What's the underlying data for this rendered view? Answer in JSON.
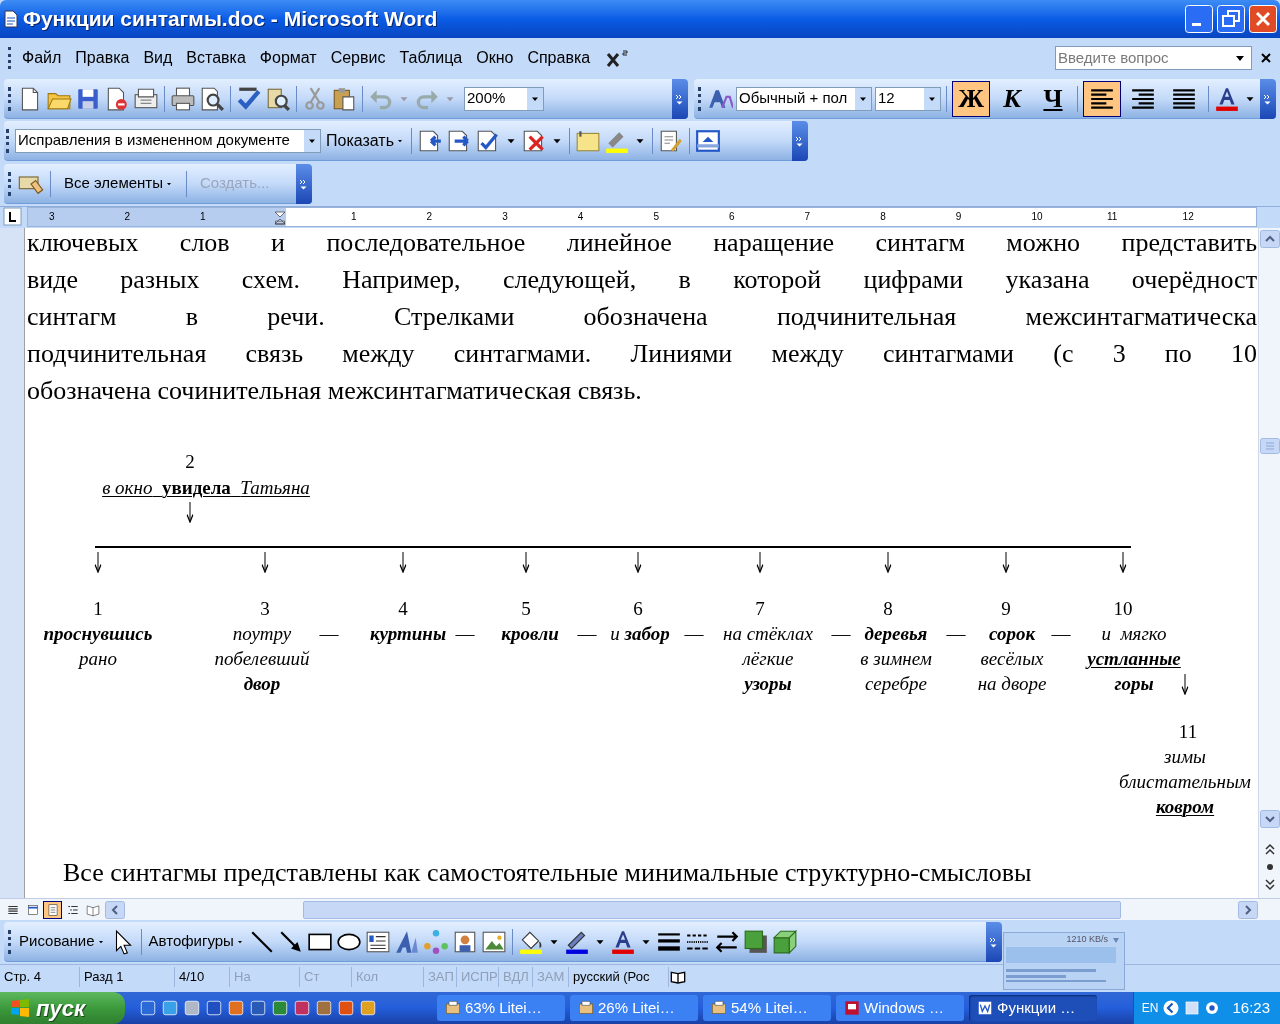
{
  "window": {
    "title": "Функции синтагмы.doc - Microsoft Word"
  },
  "menu_bar": {
    "items": [
      "Файл",
      "Правка",
      "Вид",
      "Вставка",
      "Формат",
      "Сервис",
      "Таблица",
      "Окно",
      "Справка"
    ],
    "help_field": {
      "placeholder": "Введите вопрос"
    }
  },
  "standard_toolbar": {
    "zoom": "200%"
  },
  "formatting_toolbar": {
    "style": "Обычный + пол",
    "font_size": "12",
    "buttons": [
      {
        "kind": "bold",
        "label": "Ж",
        "selected": true
      },
      {
        "kind": "italic",
        "label": "К",
        "selected": false
      },
      {
        "kind": "underline",
        "label": "Ч",
        "selected": false
      },
      {
        "kind": "align-left",
        "selected": true
      },
      {
        "kind": "align-right",
        "selected": false
      },
      {
        "kind": "justify",
        "selected": false
      }
    ]
  },
  "reviewing_toolbar": {
    "display": "Исправления в измененном документе",
    "show_menu": "Показать"
  },
  "third_toolbar": {
    "buttons": [
      {
        "label": "Все элементы",
        "disabled": false
      },
      {
        "label": "Создать...",
        "disabled": true
      }
    ]
  },
  "ruler": {
    "labels": [
      "3",
      "2",
      "1",
      "1",
      "2",
      "3",
      "4",
      "5",
      "6",
      "7",
      "8",
      "9",
      "10",
      "11",
      "12"
    ]
  },
  "document": {
    "paragraph_lines": [
      {
        "text": "ключевых слов и последовательное линейное наращение синтагм можно представить",
        "justified": true
      },
      {
        "text": "виде разных схем. Например, следующей, в которой цифрами указана очерёдност",
        "justified": true
      },
      {
        "text": "синтагм в речи. Стрелками обозначена подчинительная межсинтагматическа",
        "justified": true
      },
      {
        "text": "подчинительная связь между синтагмами. Линиями между синтагмами (с 3 по 10",
        "justified": true
      },
      {
        "text": "обозначена сочинительная межсинтагматическая связь.",
        "justified": false
      }
    ],
    "diagram": {
      "top_node": {
        "number": "2",
        "lines": [
          {
            "text": "*в окно*  **увидела**  *Татьяна*",
            "bold": false,
            "italic": false,
            "underlined": true
          }
        ]
      },
      "nodes": [
        {
          "number": "1",
          "lines": [
            {
              "text": "проснувшись",
              "bold": true,
              "italic": true,
              "underlined": false
            },
            {
              "text": "рано",
              "bold": false,
              "italic": true,
              "underlined": false
            }
          ]
        },
        {
          "number": "3",
          "lines": [
            {
              "text": "поутру",
              "bold": false,
              "italic": true,
              "underlined": false
            },
            {
              "text": "побелевший",
              "bold": false,
              "italic": true,
              "underlined": false
            },
            {
              "text": "двор",
              "bold": true,
              "italic": true,
              "underlined": false
            }
          ]
        },
        {
          "number": "4",
          "lines": [
            {
              "text": "куртины",
              "bold": true,
              "italic": true,
              "underlined": false
            }
          ]
        },
        {
          "number": "5",
          "lines": [
            {
              "text": "кровли",
              "bold": true,
              "italic": true,
              "underlined": false
            }
          ]
        },
        {
          "number": "6",
          "lines": [
            {
              "text": "и **забор**",
              "bold": false,
              "italic": true,
              "underlined": false
            }
          ]
        },
        {
          "number": "7",
          "lines": [
            {
              "text": "на стёклах",
              "bold": false,
              "italic": true,
              "underlined": false
            },
            {
              "text": "лёгкие",
              "bold": false,
              "italic": true,
              "underlined": false
            },
            {
              "text": "узоры",
              "bold": true,
              "italic": true,
              "underlined": false
            }
          ]
        },
        {
          "number": "8",
          "lines": [
            {
              "text": "деревья",
              "bold": true,
              "italic": true,
              "underlined": false
            },
            {
              "text": "в зимнем",
              "bold": false,
              "italic": true,
              "underlined": false
            },
            {
              "text": "серебре",
              "bold": false,
              "italic": true,
              "underlined": false
            }
          ]
        },
        {
          "number": "9",
          "lines": [
            {
              "text": "сорок",
              "bold": true,
              "italic": true,
              "underlined": false
            },
            {
              "text": "весёлых",
              "bold": false,
              "italic": true,
              "underlined": false
            },
            {
              "text": "на дворе",
              "bold": false,
              "italic": true,
              "underlined": false
            }
          ]
        },
        {
          "number": "10",
          "lines": [
            {
              "text": "и  мягко",
              "bold": false,
              "italic": true,
              "underlined": false
            },
            {
              "text": "устланные",
              "bold": true,
              "italic": true,
              "underlined": true
            },
            {
              "text": "горы",
              "bold": true,
              "italic": true,
              "underlined": false
            }
          ]
        }
      ],
      "separators": [
        "—",
        "—",
        "—",
        "—",
        "—",
        "—",
        "—"
      ],
      "last_node": {
        "number": "11",
        "lines": [
          {
            "text": "зимы",
            "bold": false,
            "italic": true,
            "underlined": false
          },
          {
            "text": "блистательным",
            "bold": false,
            "italic": true,
            "underlined": false
          },
          {
            "text": "ковром",
            "bold": true,
            "italic": true,
            "underlined": true
          }
        ]
      }
    },
    "next_paragraph": "Все синтагмы представлены как самостоятельные минимальные структурно-смысловы"
  },
  "view_buttons": [
    {
      "kind": "normal",
      "selected": false
    },
    {
      "kind": "web",
      "selected": false
    },
    {
      "kind": "print",
      "selected": true
    },
    {
      "kind": "outline",
      "selected": false
    },
    {
      "kind": "reading",
      "selected": false
    }
  ],
  "drawing_toolbar": {
    "draw_menu": "Рисование",
    "autoshapes_menu": "Автофигуры"
  },
  "status_bar": {
    "fields": [
      {
        "text": "Стр. 4",
        "disabled": false
      },
      {
        "text": "Разд 1",
        "disabled": false
      },
      {
        "text": "4/10",
        "disabled": false
      },
      {
        "text": "На",
        "disabled": true
      },
      {
        "text": "Ст",
        "disabled": true
      },
      {
        "text": "Кол",
        "disabled": true
      },
      {
        "text": "ЗАП",
        "disabled": true
      },
      {
        "text": "ИСПР",
        "disabled": true
      },
      {
        "text": "ВДЛ",
        "disabled": true
      },
      {
        "text": "ЗАМ",
        "disabled": true
      },
      {
        "text": "русский (Рос",
        "disabled": false
      }
    ]
  },
  "network_monitor": {
    "rate": "1210 KB/s"
  },
  "taskbar": {
    "start": "пуск",
    "tasks": [
      {
        "kind": "progress",
        "label": "63% Litei…",
        "selected": false
      },
      {
        "kind": "progress",
        "label": "26% Litei…",
        "selected": false
      },
      {
        "kind": "progress",
        "label": "54% Litei…",
        "selected": false
      },
      {
        "kind": "app",
        "label": "Windows …",
        "selected": false
      },
      {
        "kind": "word",
        "label": "Функции …",
        "selected": true
      }
    ],
    "language": "EN",
    "clock": "16:23"
  }
}
